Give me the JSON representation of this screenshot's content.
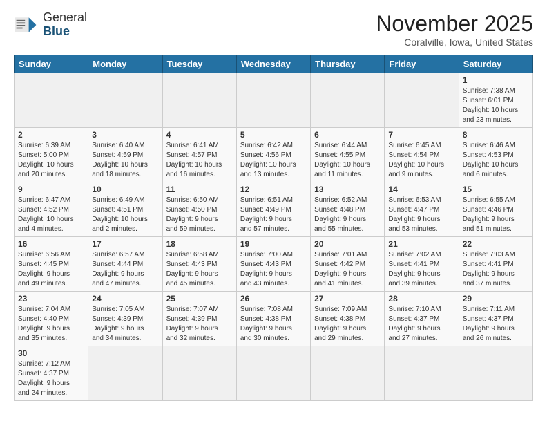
{
  "logo": {
    "general": "General",
    "blue": "Blue"
  },
  "header": {
    "month": "November 2025",
    "location": "Coralville, Iowa, United States"
  },
  "weekdays": [
    "Sunday",
    "Monday",
    "Tuesday",
    "Wednesday",
    "Thursday",
    "Friday",
    "Saturday"
  ],
  "days": [
    {
      "date": "",
      "info": ""
    },
    {
      "date": "",
      "info": ""
    },
    {
      "date": "",
      "info": ""
    },
    {
      "date": "",
      "info": ""
    },
    {
      "date": "",
      "info": ""
    },
    {
      "date": "",
      "info": ""
    },
    {
      "date": "1",
      "info": "Sunrise: 7:38 AM\nSunset: 6:01 PM\nDaylight: 10 hours\nand 23 minutes."
    },
    {
      "date": "2",
      "info": "Sunrise: 6:39 AM\nSunset: 5:00 PM\nDaylight: 10 hours\nand 20 minutes."
    },
    {
      "date": "3",
      "info": "Sunrise: 6:40 AM\nSunset: 4:59 PM\nDaylight: 10 hours\nand 18 minutes."
    },
    {
      "date": "4",
      "info": "Sunrise: 6:41 AM\nSunset: 4:57 PM\nDaylight: 10 hours\nand 16 minutes."
    },
    {
      "date": "5",
      "info": "Sunrise: 6:42 AM\nSunset: 4:56 PM\nDaylight: 10 hours\nand 13 minutes."
    },
    {
      "date": "6",
      "info": "Sunrise: 6:44 AM\nSunset: 4:55 PM\nDaylight: 10 hours\nand 11 minutes."
    },
    {
      "date": "7",
      "info": "Sunrise: 6:45 AM\nSunset: 4:54 PM\nDaylight: 10 hours\nand 9 minutes."
    },
    {
      "date": "8",
      "info": "Sunrise: 6:46 AM\nSunset: 4:53 PM\nDaylight: 10 hours\nand 6 minutes."
    },
    {
      "date": "9",
      "info": "Sunrise: 6:47 AM\nSunset: 4:52 PM\nDaylight: 10 hours\nand 4 minutes."
    },
    {
      "date": "10",
      "info": "Sunrise: 6:49 AM\nSunset: 4:51 PM\nDaylight: 10 hours\nand 2 minutes."
    },
    {
      "date": "11",
      "info": "Sunrise: 6:50 AM\nSunset: 4:50 PM\nDaylight: 9 hours\nand 59 minutes."
    },
    {
      "date": "12",
      "info": "Sunrise: 6:51 AM\nSunset: 4:49 PM\nDaylight: 9 hours\nand 57 minutes."
    },
    {
      "date": "13",
      "info": "Sunrise: 6:52 AM\nSunset: 4:48 PM\nDaylight: 9 hours\nand 55 minutes."
    },
    {
      "date": "14",
      "info": "Sunrise: 6:53 AM\nSunset: 4:47 PM\nDaylight: 9 hours\nand 53 minutes."
    },
    {
      "date": "15",
      "info": "Sunrise: 6:55 AM\nSunset: 4:46 PM\nDaylight: 9 hours\nand 51 minutes."
    },
    {
      "date": "16",
      "info": "Sunrise: 6:56 AM\nSunset: 4:45 PM\nDaylight: 9 hours\nand 49 minutes."
    },
    {
      "date": "17",
      "info": "Sunrise: 6:57 AM\nSunset: 4:44 PM\nDaylight: 9 hours\nand 47 minutes."
    },
    {
      "date": "18",
      "info": "Sunrise: 6:58 AM\nSunset: 4:43 PM\nDaylight: 9 hours\nand 45 minutes."
    },
    {
      "date": "19",
      "info": "Sunrise: 7:00 AM\nSunset: 4:43 PM\nDaylight: 9 hours\nand 43 minutes."
    },
    {
      "date": "20",
      "info": "Sunrise: 7:01 AM\nSunset: 4:42 PM\nDaylight: 9 hours\nand 41 minutes."
    },
    {
      "date": "21",
      "info": "Sunrise: 7:02 AM\nSunset: 4:41 PM\nDaylight: 9 hours\nand 39 minutes."
    },
    {
      "date": "22",
      "info": "Sunrise: 7:03 AM\nSunset: 4:41 PM\nDaylight: 9 hours\nand 37 minutes."
    },
    {
      "date": "23",
      "info": "Sunrise: 7:04 AM\nSunset: 4:40 PM\nDaylight: 9 hours\nand 35 minutes."
    },
    {
      "date": "24",
      "info": "Sunrise: 7:05 AM\nSunset: 4:39 PM\nDaylight: 9 hours\nand 34 minutes."
    },
    {
      "date": "25",
      "info": "Sunrise: 7:07 AM\nSunset: 4:39 PM\nDaylight: 9 hours\nand 32 minutes."
    },
    {
      "date": "26",
      "info": "Sunrise: 7:08 AM\nSunset: 4:38 PM\nDaylight: 9 hours\nand 30 minutes."
    },
    {
      "date": "27",
      "info": "Sunrise: 7:09 AM\nSunset: 4:38 PM\nDaylight: 9 hours\nand 29 minutes."
    },
    {
      "date": "28",
      "info": "Sunrise: 7:10 AM\nSunset: 4:37 PM\nDaylight: 9 hours\nand 27 minutes."
    },
    {
      "date": "29",
      "info": "Sunrise: 7:11 AM\nSunset: 4:37 PM\nDaylight: 9 hours\nand 26 minutes."
    },
    {
      "date": "30",
      "info": "Sunrise: 7:12 AM\nSunset: 4:37 PM\nDaylight: 9 hours\nand 24 minutes."
    },
    {
      "date": "",
      "info": ""
    },
    {
      "date": "",
      "info": ""
    },
    {
      "date": "",
      "info": ""
    },
    {
      "date": "",
      "info": ""
    },
    {
      "date": "",
      "info": ""
    },
    {
      "date": "",
      "info": ""
    }
  ]
}
